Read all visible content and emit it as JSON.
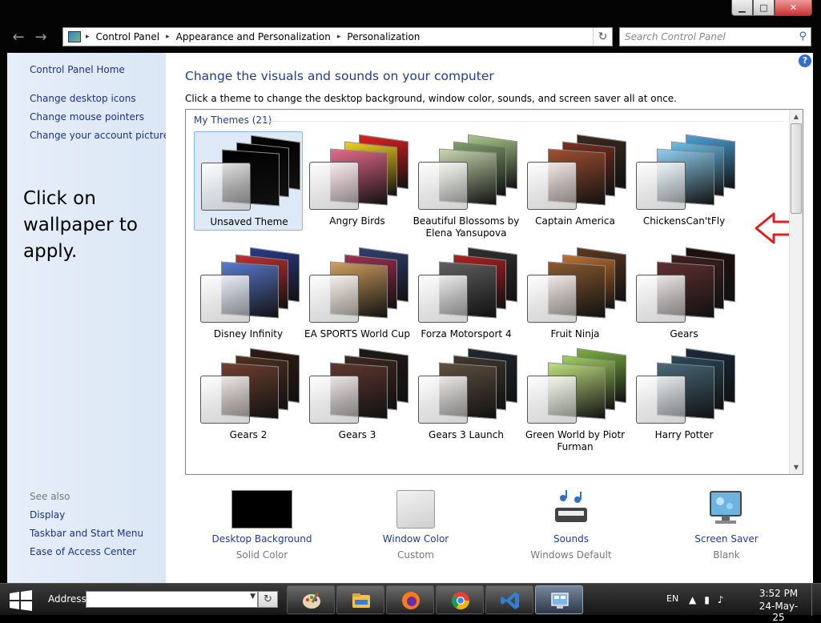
{
  "window": {
    "min": "▁",
    "max": "□",
    "close": "✕"
  },
  "nav": {
    "back": "←",
    "forward": "→"
  },
  "address_bar": {
    "crumbs": [
      "Control Panel",
      "Appearance and Personalization",
      "Personalization"
    ],
    "separator": "▸",
    "refresh": "↻"
  },
  "search": {
    "placeholder": "Search Control Panel"
  },
  "sidebar": {
    "home": "Control Panel Home",
    "links": [
      "Change desktop icons",
      "Change mouse pointers",
      "Change your account picture"
    ],
    "annotation": [
      "Click on",
      "wallpaper to",
      "apply."
    ],
    "see_also": "See also",
    "see_also_links": [
      "Display",
      "Taskbar and Start Menu",
      "Ease of Access Center"
    ]
  },
  "main": {
    "help": "?",
    "title": "Change the visuals and sounds on your computer",
    "description": "Click a theme to change the desktop background, window color, sounds, and screen saver all at once.",
    "section": "My Themes (21)"
  },
  "themes": [
    {
      "name": "Unsaved Theme",
      "selected": true,
      "colors": [
        "#000000",
        "#000000",
        "#000000"
      ]
    },
    {
      "name": "Angry Birds",
      "colors": [
        "#e02020",
        "#f0d020",
        "#e86a8a"
      ]
    },
    {
      "name": "Beautiful Blossoms by Elena Yansupova",
      "colors": [
        "#a9c88a",
        "#7fa06a",
        "#c9d8b0"
      ]
    },
    {
      "name": "Captain America",
      "colors": [
        "#3a2a20",
        "#7a3020",
        "#a05030"
      ]
    },
    {
      "name": "ChickensCan'tFly",
      "colors": [
        "#4aa0d8",
        "#6cc0e8",
        "#90d0f0"
      ]
    },
    {
      "name": "Disney Infinity",
      "colors": [
        "#2a3a8a",
        "#c03030",
        "#5a7ad0"
      ]
    },
    {
      "name": "EA SPORTS World Cup",
      "colors": [
        "#304070",
        "#a03050",
        "#d0a060"
      ]
    },
    {
      "name": "Forza Motorsport 4",
      "colors": [
        "#303030",
        "#b02020",
        "#606060"
      ]
    },
    {
      "name": "Fruit Ninja",
      "colors": [
        "#5a3a20",
        "#c07030",
        "#8a5a30"
      ]
    },
    {
      "name": "Gears",
      "colors": [
        "#201010",
        "#402020",
        "#603030"
      ]
    },
    {
      "name": "Gears 2",
      "colors": [
        "#301a10",
        "#503020",
        "#704030"
      ]
    },
    {
      "name": "Gears 3",
      "colors": [
        "#201818",
        "#402820",
        "#603830"
      ]
    },
    {
      "name": "Gears 3 Launch",
      "colors": [
        "#202830",
        "#403830",
        "#605040"
      ]
    },
    {
      "name": "Green World by Piotr Furman",
      "colors": [
        "#7ab040",
        "#a0d060",
        "#c0e080"
      ]
    },
    {
      "name": "Harry Potter",
      "colors": [
        "#1a2a3a",
        "#2a4a5a",
        "#4a6a7a"
      ]
    }
  ],
  "bottom": [
    {
      "title": "Desktop Background",
      "subtitle": "Solid Color"
    },
    {
      "title": "Window Color",
      "subtitle": "Custom"
    },
    {
      "title": "Sounds",
      "subtitle": "Windows Default"
    },
    {
      "title": "Screen Saver",
      "subtitle": "Blank"
    }
  ],
  "taskbar": {
    "address_label": "Address",
    "go": "↻",
    "apps": [
      "paint-icon",
      "file-explorer-icon",
      "firefox-icon",
      "chrome-icon",
      "vscode-icon",
      "control-panel-icon"
    ],
    "lang": "EN",
    "tray": [
      "▲",
      "▮",
      "♪"
    ],
    "time": "3:52 PM",
    "date": "24-May-25"
  },
  "colors": {
    "link": "#1e3287",
    "title": "#1e3d8f",
    "sidebar": "#e1ebf8",
    "annotation_arrow": "#e02020"
  }
}
